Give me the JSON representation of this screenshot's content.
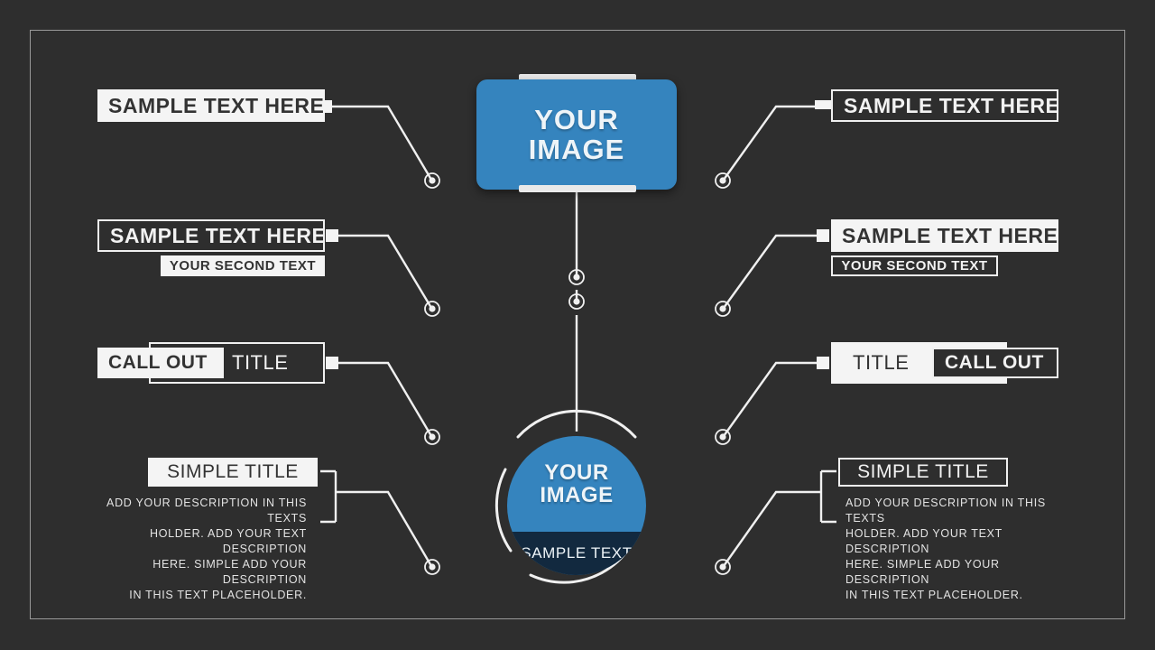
{
  "center": {
    "card": {
      "line1": "YOUR",
      "line2": "IMAGE"
    },
    "circle": {
      "line1": "YOUR",
      "line2": "IMAGE",
      "band": "SAMPLE TEXT"
    }
  },
  "left": [
    {
      "title": "SAMPLE TEXT HERE"
    },
    {
      "title": "SAMPLE TEXT HERE",
      "sub": "YOUR SECOND TEXT"
    },
    {
      "callout": "CALL OUT",
      "title": "TITLE"
    },
    {
      "title": "SIMPLE TITLE",
      "desc": "ADD YOUR DESCRIPTION IN THIS TEXTS\nHOLDER. ADD YOUR TEXT DESCRIPTION\nHERE. SIMPLE ADD YOUR DESCRIPTION\nIN THIS TEXT PLACEHOLDER."
    }
  ],
  "right": [
    {
      "title": "SAMPLE TEXT HERE"
    },
    {
      "title": "SAMPLE TEXT HERE",
      "sub": "YOUR SECOND TEXT"
    },
    {
      "title": "TITLE",
      "callout": "CALL OUT"
    },
    {
      "title": "SIMPLE TITLE",
      "desc": "ADD YOUR DESCRIPTION IN THIS TEXTS\nHOLDER. ADD YOUR TEXT DESCRIPTION\nHERE. SIMPLE ADD YOUR DESCRIPTION\nIN THIS TEXT PLACEHOLDER."
    }
  ],
  "colors": {
    "background": "#2e2e2e",
    "accent_blue": "#3584be",
    "accent_navy": "#12293f",
    "line": "#f0f0f0",
    "frame": "#9a9a9a"
  }
}
